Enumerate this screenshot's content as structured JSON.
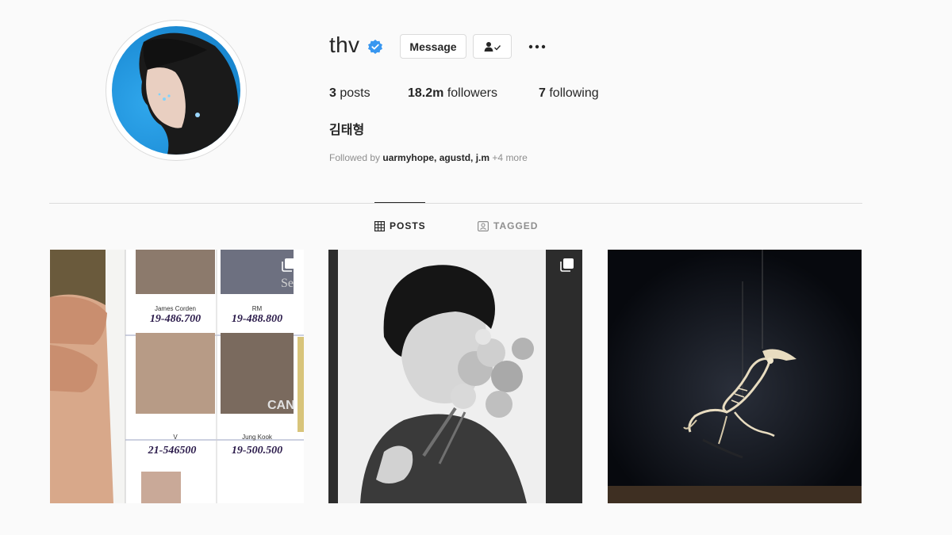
{
  "profile": {
    "username": "thv",
    "full_name": "김태형",
    "message_label": "Message",
    "stats": {
      "posts_count": "3",
      "posts_label": "posts",
      "followers_count": "18.2m",
      "followers_label": "followers",
      "following_count": "7",
      "following_label": "following"
    },
    "followed_by": {
      "prefix": "Followed by",
      "names": "uarmyhope, agustd, j.m",
      "more": "+4 more"
    }
  },
  "tabs": {
    "posts_label": "POSTS",
    "tagged_label": "TAGGED"
  },
  "posts": [
    {
      "caption_names": [
        "James Corden",
        "RM",
        "V",
        "Jung Kook"
      ],
      "numbers": [
        "19-486.700",
        "19-488.800",
        "21-546500",
        "19-500.500"
      ],
      "badge_text": "Se",
      "badge_text2": "CAN"
    },
    {},
    {}
  ],
  "colors": {
    "verified_blue": "#3897f0",
    "text_primary": "#262626",
    "text_secondary": "#8e8e8e",
    "border": "#dbdbdb",
    "background": "#fafafa"
  },
  "icons": {
    "verified": "verified-badge-icon",
    "follow": "following-person-check-icon",
    "more": "more-options-icon",
    "posts_tab": "grid-icon",
    "tagged_tab": "tagged-icon",
    "multi": "multiple-photos-icon"
  }
}
